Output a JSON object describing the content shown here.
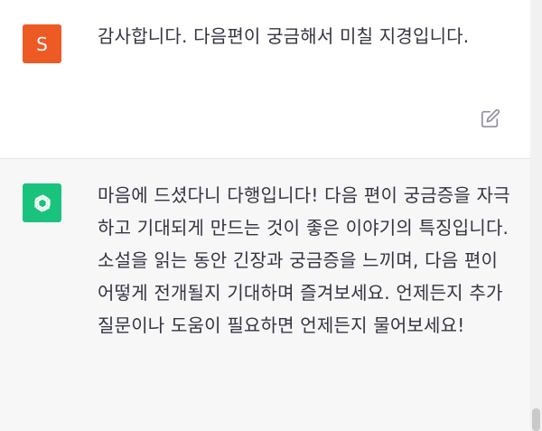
{
  "user_message": {
    "avatar_letter": "S",
    "avatar_color": "#ee5a24",
    "text": "감사합니다. 다음편이 궁금해서 미칠 지경입니다."
  },
  "assistant_message": {
    "avatar_icon": "openai-logo-icon",
    "avatar_color": "#19c37d",
    "text": "마음에 드셨다니 다행입니다! 다음 편이 궁금증을 자극하고 기대되게 만드는 것이 좋은 이야기의 특징입니다. 소설을 읽는 동안 긴장과 궁금증을 느끼며, 다음 편이 어떻게 전개될지 기대하며 즐겨보세요. 언제든지 추가 질문이나 도움이 필요하면 언제든지 물어보세요!"
  },
  "actions": {
    "edit_icon": "edit-icon"
  }
}
